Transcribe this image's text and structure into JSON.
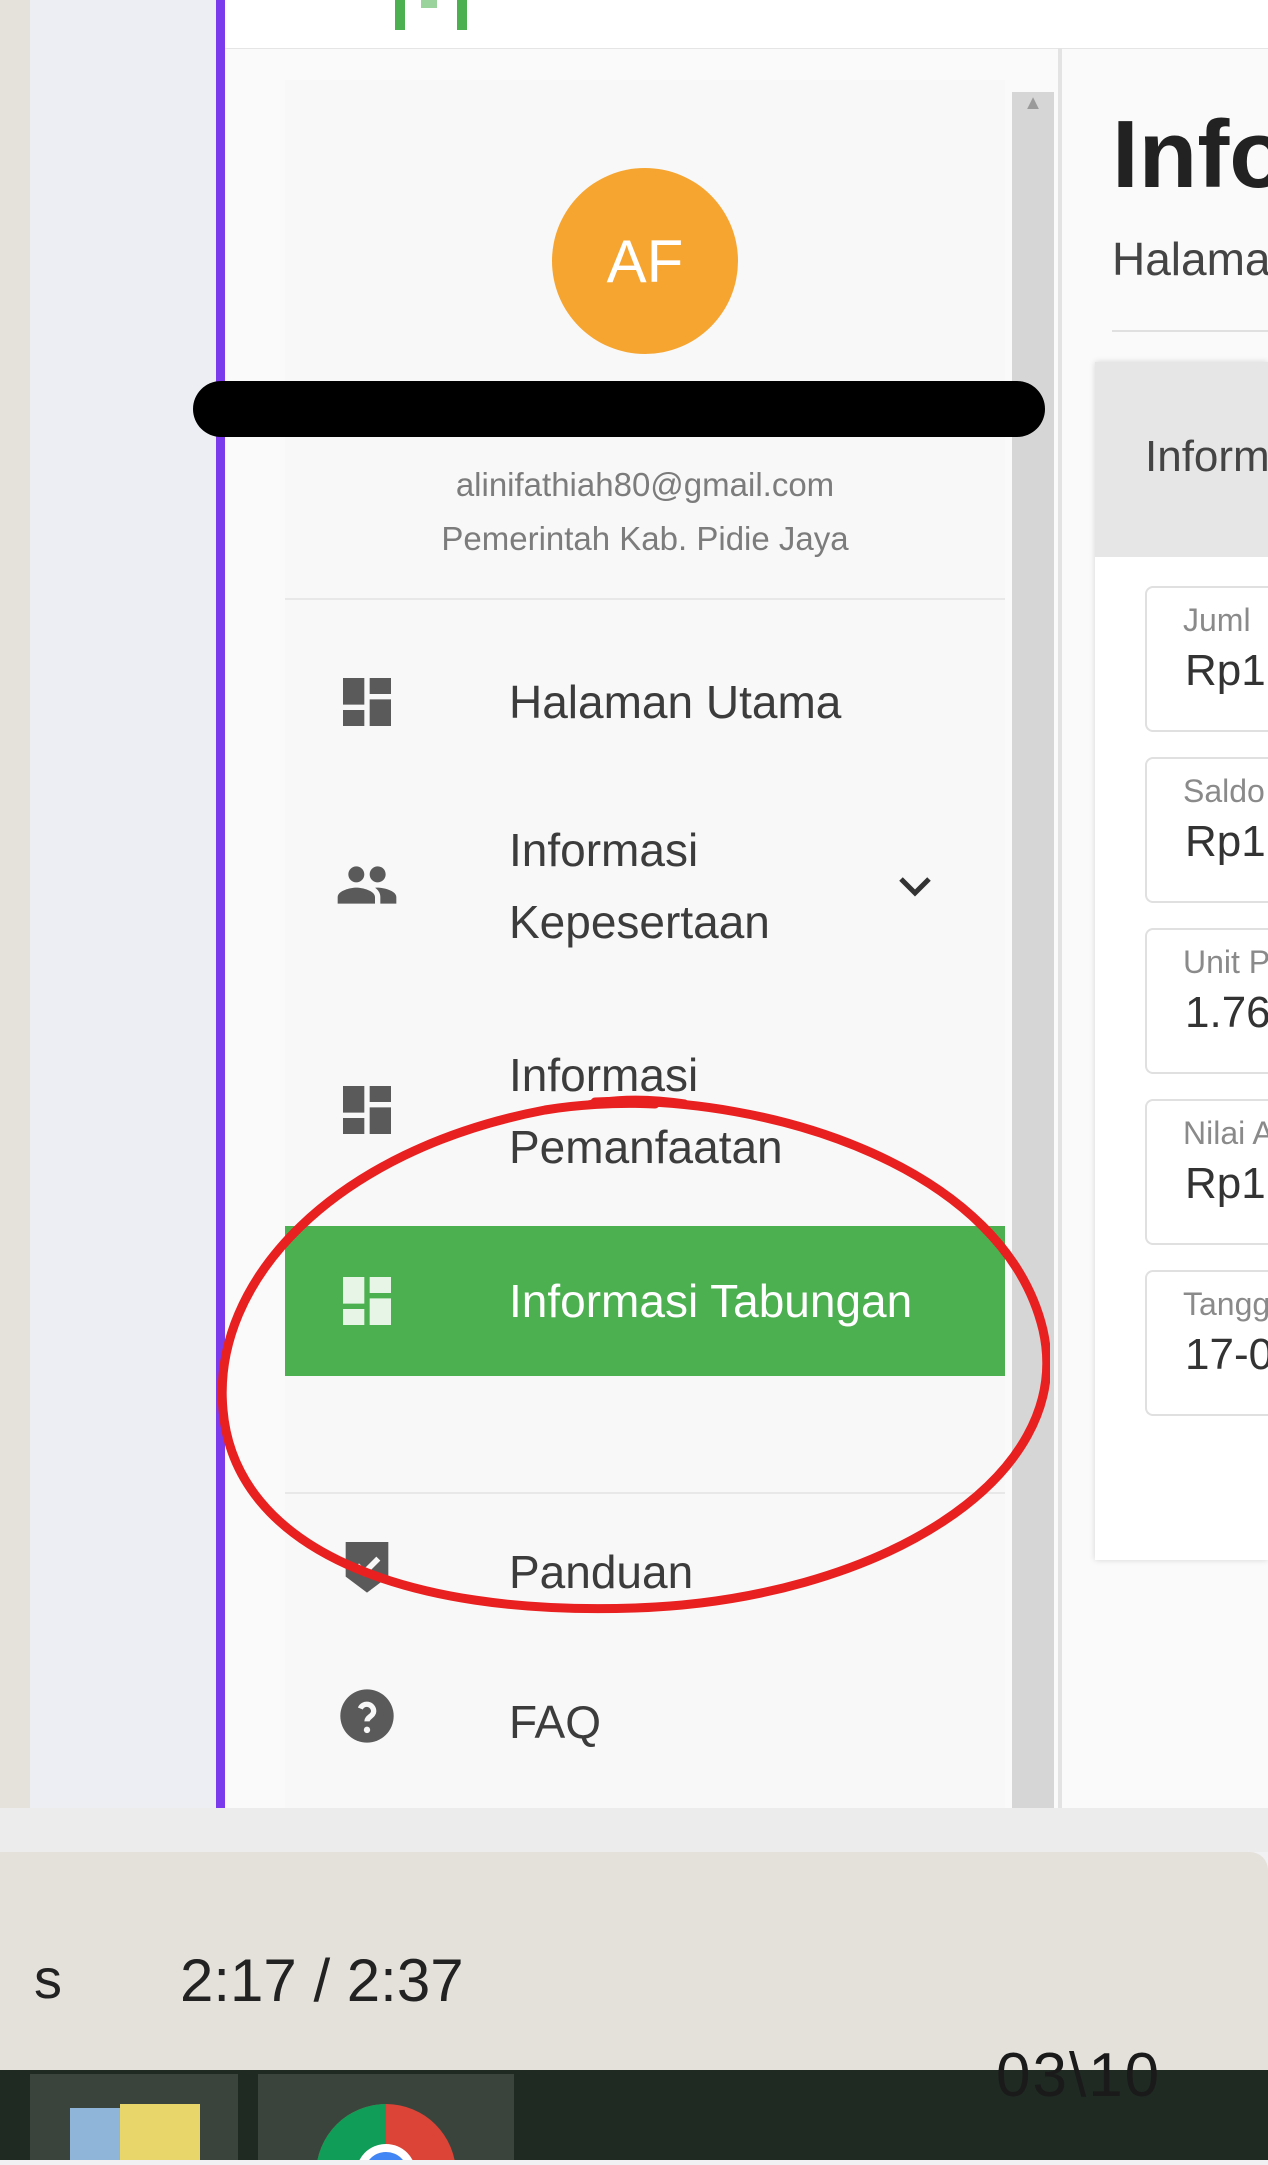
{
  "profile": {
    "initials": "AF",
    "email": "alinifathiah80@gmail.com",
    "organization": "Pemerintah Kab. Pidie Jaya"
  },
  "menu": {
    "home": "Halaman Utama",
    "membership_line1": "Informasi",
    "membership_line2": "Kepesertaan",
    "utilization_line1": "Informasi",
    "utilization_line2": "Pemanfaatan",
    "savings": "Informasi Tabungan",
    "guide": "Panduan",
    "faq": "FAQ"
  },
  "main": {
    "title": "Info",
    "breadcrumb": "Halama",
    "card_title": "Inform",
    "fields": [
      {
        "label": "Juml",
        "value": "Rp1."
      },
      {
        "label": "Saldo",
        "value": "Rp1."
      },
      {
        "label": "Unit P",
        "value": "1.76"
      },
      {
        "label": "Nilai A",
        "value": "Rp1."
      },
      {
        "label": "Tangg",
        "value": "17-0"
      }
    ]
  },
  "player": {
    "partial_label": "s",
    "time": "2:17 / 2:37"
  },
  "slide_counter": "03\\10",
  "colors": {
    "accent_green": "#4caf50",
    "avatar_orange": "#f6a531",
    "annotation_red": "#e82020",
    "border_purple": "#7c3aed"
  }
}
